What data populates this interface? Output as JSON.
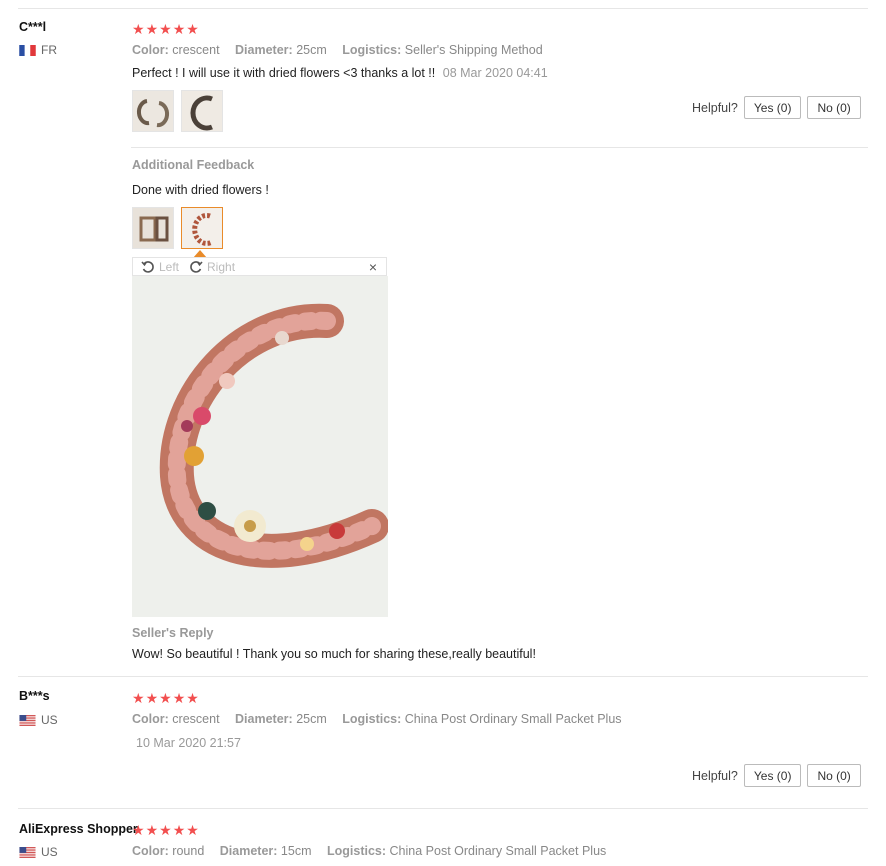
{
  "reviews": [
    {
      "user": "C***l",
      "country": "FR",
      "rating": 5,
      "attributes": [
        {
          "key": "Color:",
          "value": "crescent"
        },
        {
          "key": "Diameter:",
          "value": "25cm"
        },
        {
          "key": "Logistics:",
          "value": "Seller's Shipping Method"
        }
      ],
      "text": "Perfect ! I will use it with dried flowers <3 thanks a lot !!",
      "date": "08 Mar 2020 04:41",
      "helpful_label": "Helpful?",
      "yes_label": "Yes (0)",
      "no_label": "No (0)",
      "additional_title": "Additional Feedback",
      "additional_text": "Done with dried flowers !",
      "viewer": {
        "left_label": "Left",
        "right_label": "Right",
        "close": "×"
      },
      "seller_reply_title": "Seller's Reply",
      "seller_reply_text": "Wow! So beautiful ! Thank you so much for sharing these,really beautiful!"
    },
    {
      "user": "B***s",
      "country": "US",
      "rating": 5,
      "attributes": [
        {
          "key": "Color:",
          "value": "crescent"
        },
        {
          "key": "Diameter:",
          "value": "25cm"
        },
        {
          "key": "Logistics:",
          "value": "China Post Ordinary Small Packet Plus"
        }
      ],
      "date": "10 Mar 2020 21:57",
      "helpful_label": "Helpful?",
      "yes_label": "Yes (0)",
      "no_label": "No (0)"
    },
    {
      "user": "AliExpress Shopper",
      "country": "US",
      "rating": 5,
      "attributes": [
        {
          "key": "Color:",
          "value": "round"
        },
        {
          "key": "Diameter:",
          "value": "15cm"
        },
        {
          "key": "Logistics:",
          "value": "China Post Ordinary Small Packet Plus"
        }
      ]
    }
  ],
  "colors": {
    "star": "#f24f4f",
    "active_thumb": "#e98b2a"
  },
  "icons": [
    "star-icon",
    "flag-fr-icon",
    "flag-us-icon",
    "rotate-left-icon",
    "rotate-right-icon",
    "close-icon"
  ]
}
